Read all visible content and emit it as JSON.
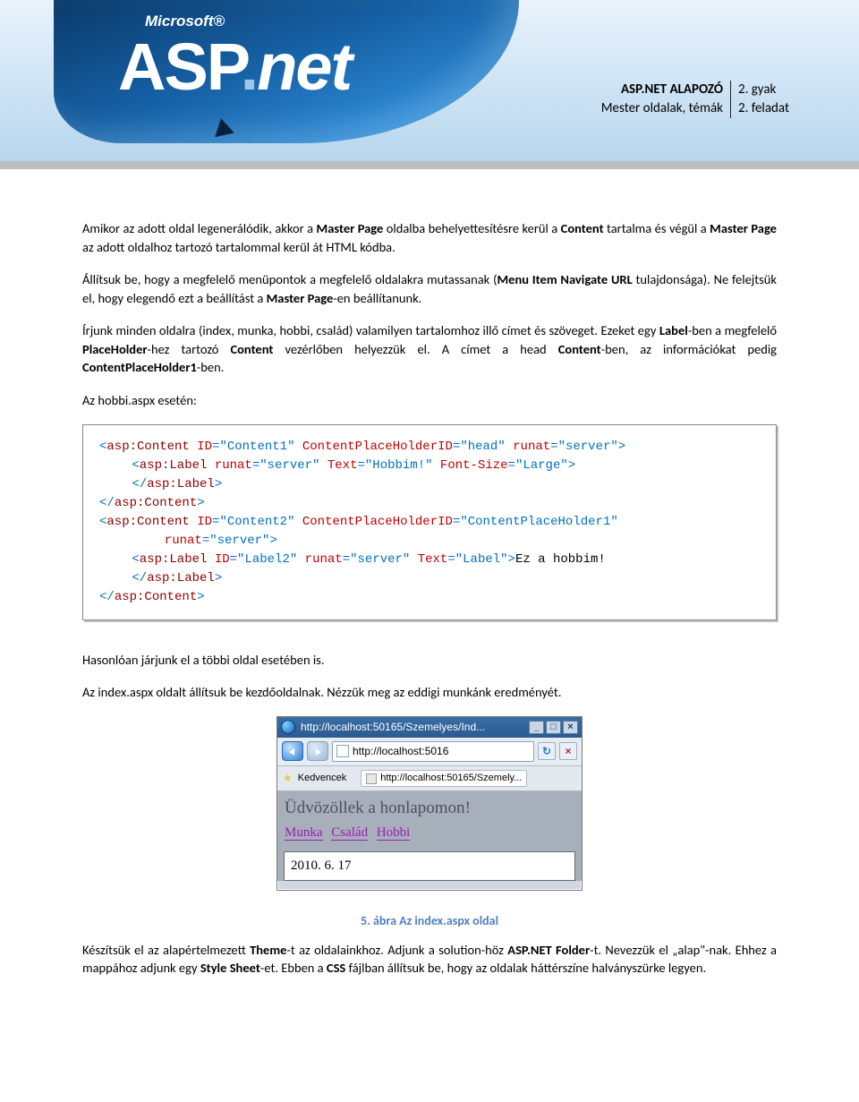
{
  "hero": {
    "ms": "Microsoft®",
    "asp_a": "ASP",
    "asp_dot": ".",
    "asp_net": "net"
  },
  "header": {
    "left_top": "ASP.NET ALAPOZÓ",
    "left_bot": "Mester oldalak, témák",
    "right_top": "2. gyak",
    "right_bot": "2. feladat"
  },
  "p1a": "Amikor az adott oldal legenerálódik, akkor a ",
  "p1b": "Master Page",
  "p1c": " oldalba behelyettesítésre kerül a ",
  "p1d": "Content",
  "p1e": " tartalma és végül a ",
  "p1f": "Master Page",
  "p1g": " az adott oldalhoz tartozó tartalommal kerül át HTML kódba.",
  "p2a": "Állítsuk be, hogy a megfelelő menüpontok a megfelelő oldalakra mutassanak (",
  "p2b": "Menu Item Navigate URL",
  "p2c": " tulajdonsága). Ne felejtsük el, hogy elegendő ezt a beállítást a ",
  "p2d": "Master Page",
  "p2e": "-en beállítanunk.",
  "p3a": "Írjunk minden oldalra (index, munka, hobbi, család) valamilyen tartalomhoz illő címet és szöveget. Ezeket egy ",
  "p3b": "Label",
  "p3c": "-ben a megfelelő ",
  "p3d": "PlaceHolder",
  "p3e": "-hez tartozó ",
  "p3f": "Content",
  "p3g": " vezérlőben helyezzük el. A címet a head ",
  "p3h": "Content",
  "p3i": "-ben, az információkat pedig ",
  "p3j": "ContentPlaceHolder1",
  "p3k": "-ben.",
  "p4": "Az hobbi.aspx esetén:",
  "code": {
    "l1": {
      "open": "<",
      "el1": "asp:Content",
      "sp": " ",
      "at1": "ID",
      "eq": "=",
      "v1": "\"Content1\"",
      "at2": "ContentPlaceHolderID",
      "v2": "\"head\"",
      "at3": "runat",
      "v3": "\"server\"",
      "end": ">"
    },
    "l2": {
      "open": "<",
      "el": "asp:Label",
      "at1": "runat",
      "v1": "\"server\"",
      "at2": "Text",
      "v2": "\"Hobbim!\"",
      "at3": "Font-Size",
      "v3": "\"Large\"",
      "end": ">"
    },
    "l3": {
      "open": "</",
      "el": "asp:Label",
      "end": ">"
    },
    "l4": {
      "open": "</",
      "el": "asp:Content",
      "end": ">"
    },
    "l5": {
      "open": "<",
      "el": "asp:Content",
      "at1": "ID",
      "v1": "\"Content2\"",
      "at2": "ContentPlaceHolderID",
      "v2": "\"ContentPlaceHolder1\""
    },
    "l5b": {
      "at3": "runat",
      "v3": "\"server\"",
      "end": ">"
    },
    "l6": {
      "open": "<",
      "el": "asp:Label",
      "at1": "ID",
      "v1": "\"Label2\"",
      "at2": "runat",
      "v2": "\"server\"",
      "at3": "Text",
      "v3": "\"Label\"",
      "end": ">",
      "txt": "Ez a hobbim!"
    },
    "l7": {
      "open": "</",
      "el": "asp:Label",
      "end": ">"
    },
    "l8": {
      "open": "</",
      "el": "asp:Content",
      "end": ">"
    }
  },
  "p5": "Hasonlóan járjunk el a többi oldal esetében is.",
  "p6": "Az index.aspx oldalt állítsuk be kezdőoldalnak. Nézzük meg az eddigi munkánk eredményét.",
  "browser": {
    "title": "http://localhost:50165/Szemelyes/Ind...",
    "addr": "http://localhost:5016",
    "fav": "Kedvencek",
    "tab": "http://localhost:50165/Szemely...",
    "welcome": "Üdvözöllek a honlapomon!",
    "menu1": "Munka",
    "menu2": "Család",
    "menu3": "Hobbi",
    "date": "2010. 6. 17"
  },
  "figcaption": "5. ábra Az index.aspx oldal",
  "p7a": "Készítsük el az alapértelmezett ",
  "p7b": "Theme",
  "p7c": "-t az oldalainkhoz. Adjunk a solution-höz ",
  "p7d": "ASP.NET Folder",
  "p7e": "-t. Nevezzük el „alap\"-nak. Ehhez a mappához adjunk egy ",
  "p7f": "Style Sheet",
  "p7g": "-et. Ebben a ",
  "p7h": "CSS",
  "p7i": " fájlban állítsuk be, hogy az oldalak háttérszíne halványszürke legyen."
}
